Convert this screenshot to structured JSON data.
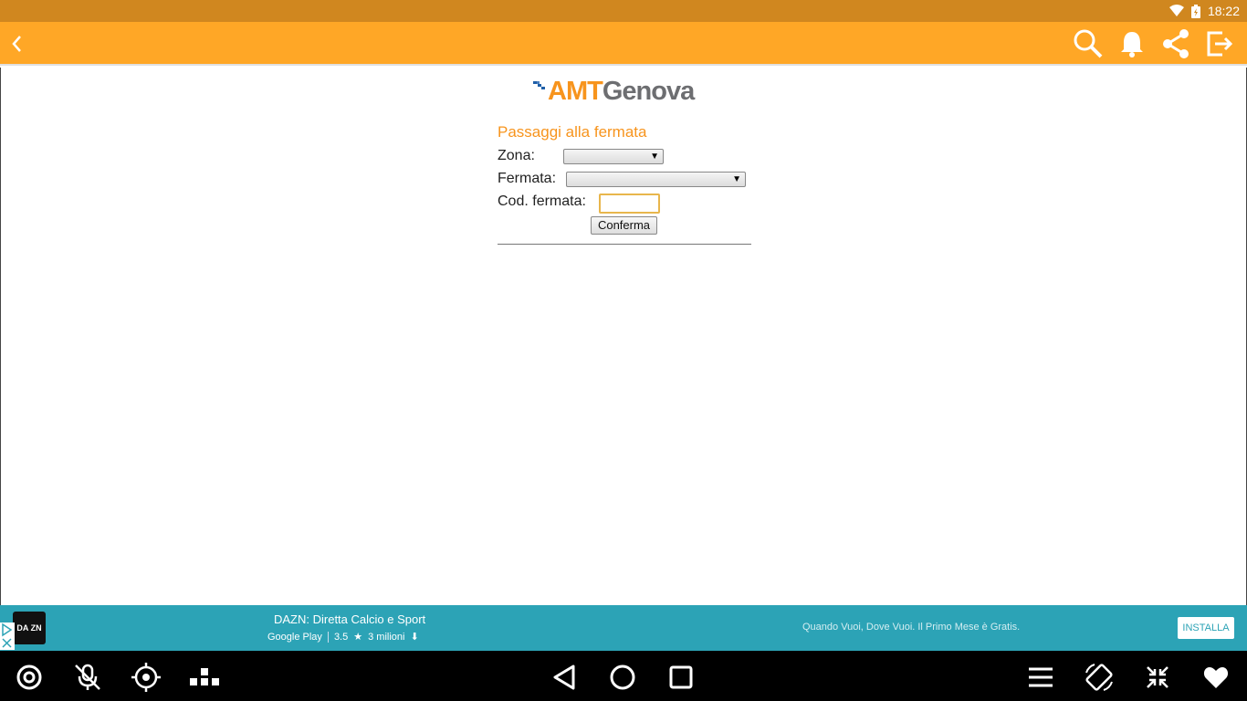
{
  "status_bar": {
    "time": "18:22"
  },
  "app_bar": {
    "icons": [
      "back-icon",
      "search-icon",
      "bell-icon",
      "share-icon",
      "exit-icon"
    ]
  },
  "page": {
    "logo": {
      "prefix": "AMT",
      "suffix": "Genova"
    },
    "form_title": "Passaggi alla fermata",
    "zona_label": "Zona:",
    "zona_value": "",
    "fermata_label": "Fermata:",
    "fermata_value": "",
    "cod_label": "Cod. fermata:",
    "cod_value": "",
    "confirm_label": "Conferma"
  },
  "ad": {
    "logo_text": "DA ZN",
    "title": "DAZN: Diretta Calcio e Sport",
    "store": "Google Play",
    "rating": "3.5",
    "downloads": "3 milioni",
    "description": "Quando Vuoi, Dove Vuoi. Il Primo Mese è Gratis.",
    "install_label": "INSTALLA"
  },
  "nav_bar": {
    "left_icons": [
      "target-circle-icon",
      "mic-off-icon",
      "crosshair-icon",
      "keyboard-icon"
    ],
    "center_icons": [
      "nav-back-icon",
      "nav-home-icon",
      "nav-recents-icon"
    ],
    "right_icons": [
      "menu-icon",
      "rotate-icon",
      "collapse-icon",
      "heart-icon"
    ]
  },
  "colors": {
    "status_bar": "#d0871f",
    "app_bar": "#ffa726",
    "brand_orange": "#f7941d",
    "ad_bar": "#2ca3b6",
    "nav_bar": "#000000"
  }
}
